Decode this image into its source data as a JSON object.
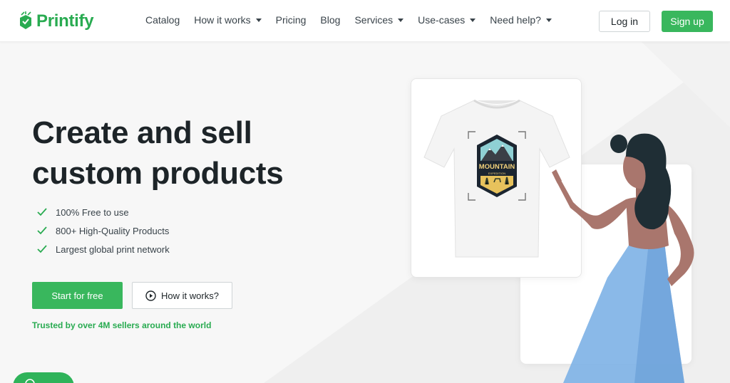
{
  "brand": {
    "name": "Printify",
    "color": "#29ab51"
  },
  "nav": {
    "items": [
      {
        "label": "Catalog",
        "dropdown": false
      },
      {
        "label": "How it works",
        "dropdown": true
      },
      {
        "label": "Pricing",
        "dropdown": false
      },
      {
        "label": "Blog",
        "dropdown": false
      },
      {
        "label": "Services",
        "dropdown": true
      },
      {
        "label": "Use-cases",
        "dropdown": true
      },
      {
        "label": "Need help?",
        "dropdown": true
      }
    ],
    "login_label": "Log in",
    "signup_label": "Sign up"
  },
  "hero": {
    "title_line1": "Create and sell",
    "title_line2": "custom products",
    "features": [
      "100% Free to use",
      "800+ High-Quality Products",
      "Largest global print network"
    ],
    "start_label": "Start for free",
    "how_label": "How it works?",
    "trusted_text": "Trusted by over 4M sellers around the world"
  },
  "artwork": {
    "badge_title": "MOUNTAIN",
    "badge_subtitle": "EXPEDITION"
  },
  "colors": {
    "accent": "#39b75d",
    "text_dark": "#1d2428",
    "page_bg": "#f7f7f7"
  },
  "icons": {
    "logo": "printify-logo-icon",
    "feature_bullet": "check-icon",
    "how_button": "play-circle-icon",
    "nav_dropdown": "caret-down-icon",
    "chat": "chat-icon"
  }
}
